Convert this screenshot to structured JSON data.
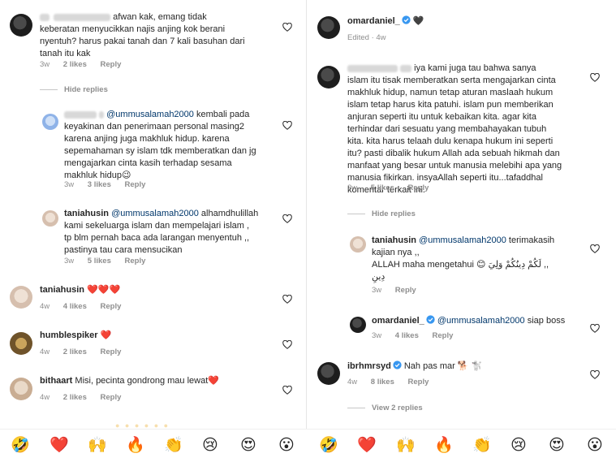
{
  "left": {
    "c1": {
      "line1_tail": "afwan kak, emang tidak",
      "line2": "keberatan menyucikkan najis anjing kok berani",
      "line3": "nyentuh? harus pakai tanah dan 7 kali basuhan dari",
      "line4": "tanah itu kak",
      "time": "3w",
      "likes": "2 likes",
      "reply": "Reply"
    },
    "hide_replies": "Hide replies",
    "c2": {
      "mention": "@ummusalamah2000",
      "line1_tail": "kembali pada",
      "line2": "keyakinan dan penerimaan personal masing2",
      "line3": "karena anjing juga makhluk hidup. karena",
      "line4": "sepemahaman sy islam tdk memberatkan dan jg",
      "line5": "mengajarkan cinta kasih terhadap sesama",
      "line6": "makhluk hidup",
      "line6_emoji": "😉",
      "time": "3w",
      "likes": "3 likes",
      "reply": "Reply"
    },
    "c3": {
      "user": "taniahusin",
      "mention": "@ummusalamah2000",
      "line1_tail": "alhamdhulillah",
      "line2": "kami sekeluarga islam dan mempelajari islam ,",
      "line3": "tp blm pernah baca ada larangan menyentuh ,,",
      "line4": "pastinya tau cara mensucikan",
      "time": "3w",
      "likes": "5 likes",
      "reply": "Reply"
    },
    "c4": {
      "user": "taniahusin",
      "body": "❤️❤️❤️",
      "time": "4w",
      "likes": "4 likes",
      "reply": "Reply"
    },
    "c5": {
      "user": "humblespiker",
      "body": "❤️",
      "time": "4w",
      "likes": "2 likes",
      "reply": "Reply"
    },
    "c6": {
      "user": "bithaart",
      "body": "Misi, pecinta gondrong mau lewat",
      "body_emoji": "❤️",
      "time": "4w",
      "likes": "2 likes",
      "reply": "Reply"
    }
  },
  "right": {
    "post": {
      "user": "omardaniel_",
      "emoji": "🖤",
      "edited": "Edited · 4w"
    },
    "c1": {
      "line1_tail": "iya kami juga tau bahwa sanya",
      "line2": "islam itu tisak memberatkan serta mengajarkan cinta",
      "line3": "makhluk hidup, namun tetap aturan maslaah hukum",
      "line4": "islam tetap harus kita patuhi. islam pun memberikan",
      "line5": "anjuran seperti itu untuk kebaikan kita. agar kita",
      "line6": "terhindar dari sesuatu yang membahayakan tubuh",
      "line7": "kita. kita harus telaah dulu kenapa hukum ini seperti",
      "line8": "itu? pasti dibalik hukum Allah ada sebuah hikmah dan",
      "line9": "manfaat yang besar untuk manusia melebihi apa yang",
      "line10": "manusia fikirkan. insyaAllah seperti itu...tafaddhal",
      "line11": "komentar terkait ini.",
      "time": "3w",
      "likes": "5 likes",
      "reply": "Reply"
    },
    "hide_replies": "Hide replies",
    "c2": {
      "user": "taniahusin",
      "mention": "@ummusalamah2000",
      "line1_tail": "terimakasih",
      "line2": "kajian nya ,,",
      "line3_a": "ALLAH maha mengetahui",
      "line3_emoji": "😊",
      "line3_arabic": ",, لَكُمْ دِينُكُمْ وَلِيَ",
      "line4_arabic": "دِينِ",
      "time": "3w",
      "reply": "Reply"
    },
    "c3": {
      "user": "omardaniel_",
      "mention": "@ummusalamah2000",
      "tail": "siap boss",
      "time": "3w",
      "likes": "4 likes",
      "reply": "Reply"
    },
    "c4": {
      "user": "ibrhmrsyd",
      "body": "Nah pas mar",
      "body_emoji": "🐕 🐩",
      "time": "4w",
      "likes": "8 likes",
      "reply": "Reply"
    },
    "view_replies": "View 2 replies"
  },
  "emoji_bar": [
    "🤣",
    "❤️",
    "🙌",
    "🔥",
    "👏",
    "😢",
    "😍",
    "😮",
    "🤣",
    "❤️",
    "🙌",
    "🔥",
    "👏",
    "😢",
    "😍",
    "😮"
  ],
  "colors": {
    "text": "#262626",
    "meta": "#8e8e8e",
    "mention": "#00376b",
    "verified": "#3897f0",
    "heart_red": "#ed4956"
  }
}
